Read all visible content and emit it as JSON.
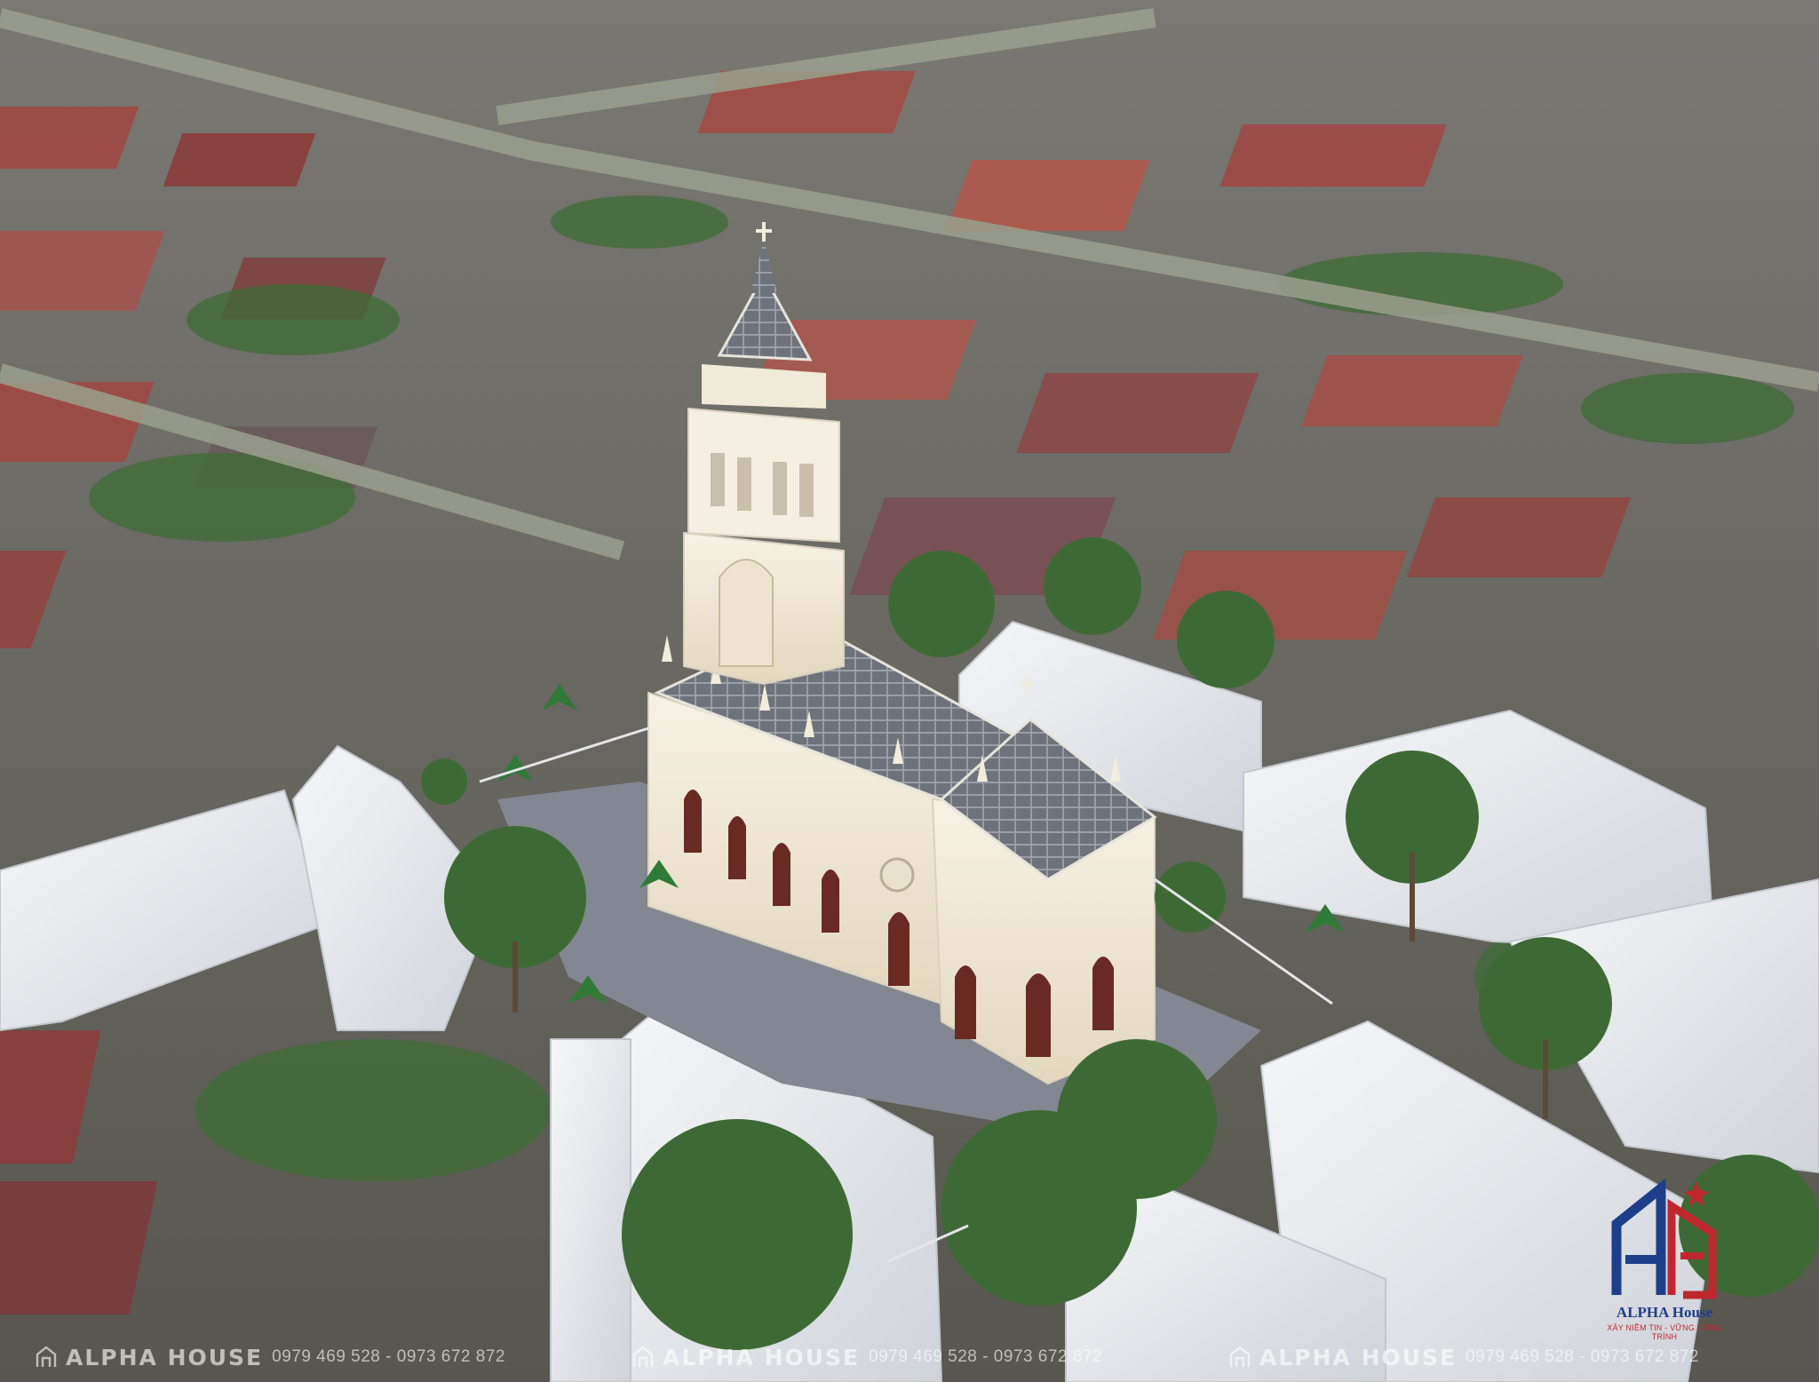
{
  "image": {
    "subject": "aerial-render",
    "colors": {
      "roof_red": "#9e4a45",
      "tree_green": "#3f6b37",
      "church_cream": "#efe8d6",
      "roof_slate": "#6d7077",
      "block_white": "#eef0f3"
    }
  },
  "watermarks": [
    {
      "brand": "ALPHA HOUSE",
      "phones": "0979 469 528 - 0973 672 872"
    },
    {
      "brand": "ALPHA HOUSE",
      "phones": "0979 469 528 - 0973 672 872"
    },
    {
      "brand": "ALPHA HOUSE",
      "phones": "0979 469 528 - 0973 672 872"
    }
  ],
  "logo": {
    "name": "ALPHA House",
    "slogan": "XÂY NIỀM TIN - VỮNG CÔNG TRÌNH",
    "colors": {
      "blue": "#1d3e8a",
      "red": "#c0272d"
    }
  }
}
